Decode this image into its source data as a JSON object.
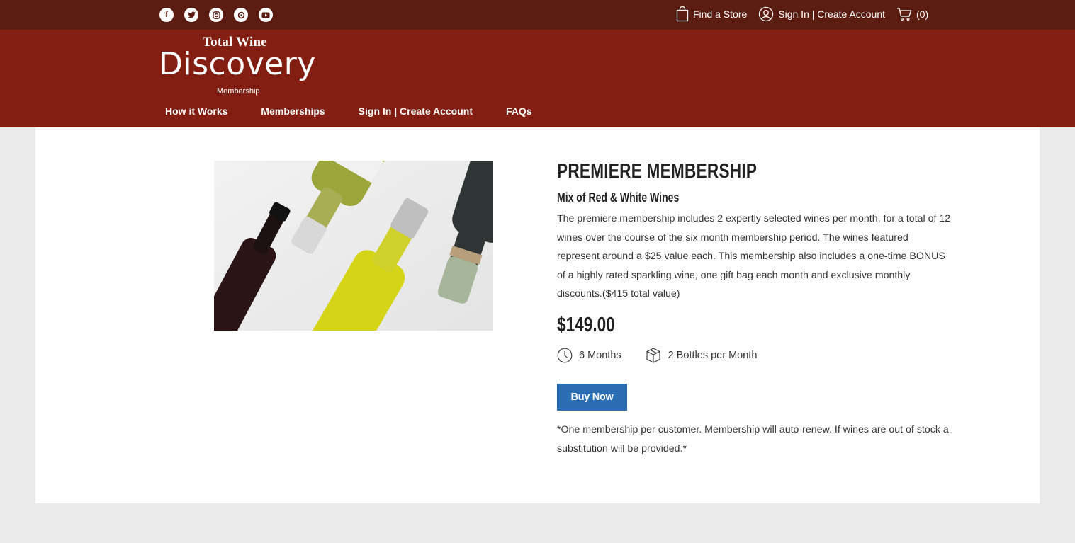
{
  "topbar": {
    "social_icons": [
      "facebook-icon",
      "twitter-icon",
      "instagram-icon",
      "pinterest-icon",
      "youtube-icon"
    ],
    "find_store": "Find a Store",
    "sign_in": "Sign In | Create Account",
    "cart": "(0)"
  },
  "logo": {
    "top": "Total Wine",
    "main": "Discovery",
    "sub": "Membership"
  },
  "nav": {
    "items": [
      "How it Works",
      "Memberships",
      "Sign In | Create Account",
      "FAQs"
    ]
  },
  "product": {
    "title": "PREMIERE MEMBERSHIP",
    "subtitle": "Mix of Red & White Wines",
    "description": "The premiere membership includes 2 expertly selected wines per month, for a total of 12 wines over the course of the six month membership period. The wines featured represent around a $25 value each. This membership also includes a one-time BONUS of a highly rated sparkling wine, one gift bag each month and exclusive monthly discounts.($415 total value)",
    "price": "$149.00",
    "duration": "6 Months",
    "bottles": "2 Bottles per Month",
    "buy_label": "Buy Now",
    "disclaimer": "*One membership per customer. Membership will auto-renew. If wines are out of stock a substitution will be provided.*"
  },
  "colors": {
    "topbar": "#5b1d11",
    "header": "#831e12",
    "button": "#2b6db3",
    "page_bg": "#ebebeb"
  }
}
